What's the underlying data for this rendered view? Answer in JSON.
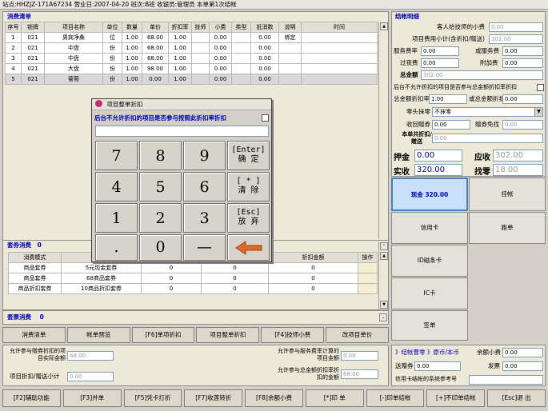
{
  "status_bar": "站点:HHZJZ-171A67234 营业日:2007-04-20 班次:B班 收银员:管理员 本单第1次结帐",
  "consume_list": {
    "title": "消费清单",
    "columns": [
      "序号",
      "锁牌",
      "项目名称",
      "单位",
      "数量",
      "单价",
      "折扣率",
      "技师",
      "小费",
      "类型",
      "抵消数",
      "说明",
      "时间"
    ],
    "rows": [
      [
        "1",
        "021",
        "男宾净桑",
        "位",
        "1.00",
        "68.00",
        "1.00",
        "",
        "0.00",
        "",
        "0.00",
        "绑定",
        ""
      ],
      [
        "2",
        "021",
        "中盘",
        "份",
        "1.00",
        "68.00",
        "1.00",
        "",
        "0.00",
        "",
        "0.00",
        "",
        ""
      ],
      [
        "3",
        "021",
        "中盘",
        "份",
        "1.00",
        "68.00",
        "1.00",
        "",
        "0.00",
        "",
        "0.00",
        "",
        ""
      ],
      [
        "4",
        "021",
        "大盘",
        "份",
        "1.00",
        "98.00",
        "1.00",
        "",
        "0.00",
        "",
        "0.00",
        "",
        ""
      ],
      [
        "5",
        "021",
        "菊萄",
        "份",
        "1.00",
        "0.00",
        "1.00",
        "",
        "0.00",
        "",
        "0.00",
        "",
        ""
      ]
    ]
  },
  "voucher": {
    "title": "套券消费",
    "count": "0",
    "columns": [
      "消费模式",
      "",
      "",
      "",
      "折扣金额",
      "操作"
    ],
    "rows": [
      [
        "商品套券",
        "5元现金套券",
        "0",
        "0",
        "0",
        ""
      ],
      [
        "商品套券",
        "68商品套券",
        "0",
        "0",
        "0",
        ""
      ],
      [
        "商品折扣套券",
        "10商品折扣套券",
        "0",
        "0",
        "0",
        ""
      ]
    ]
  },
  "package": {
    "title": "套票消费",
    "count": "0"
  },
  "action_buttons": [
    "消费清单",
    "帐单预览",
    "[F6]单项折扣",
    "项目整单折扣",
    "[F4]技师小费",
    "改项目单价"
  ],
  "bottom_left": {
    "allow_free_label": "允许参与赠券折扣的项目实际金额",
    "allow_free_value": "68.00",
    "subtotal_label": "项目折扣/赠送小计",
    "subtotal_value": "0.00",
    "allow_service_label": "允许参与服务费率计算的项目金额",
    "allow_service_value": "0.00",
    "allow_total_label": "允许参与总金额折扣率折扣的金额",
    "allow_total_value": "68.00"
  },
  "function_keys": [
    "[F2]辅助功能",
    "[F3]并单",
    "[F5]凭卡打折",
    "[F7]收莲转折",
    "[F8]余额小费",
    "[*]印 单",
    "[-]印单结帐",
    "[+]不印单结帐",
    "[Esc]退 出"
  ],
  "settlement": {
    "title": "结帐明细",
    "guest_tip_label": "客人给技师的小费",
    "guest_tip_value": "0.00",
    "item_total_label": "项目费用小计(含折扣/赠送)",
    "item_total_value": "302.00",
    "service_rate_label": "服务费率",
    "service_rate_value": "0.00",
    "service_fee_label": "或服务费",
    "service_fee_value": "0.00",
    "overnight_label": "过夜费",
    "overnight_value": "0.00",
    "extra_fee_label": "附加费",
    "extra_fee_value": "0.00",
    "total_label": "总金额",
    "total_value": "302.00",
    "no_discount_label": "后台不允许折扣的项目是否参与总金额折扣率折扣",
    "total_rate_label": "总金额折扣率",
    "total_rate_value": "1.00",
    "total_amount_label": "或总金额折扣",
    "total_amount_value": "0.00",
    "rounding_label": "零头抹零",
    "rounding_value": "不抹零",
    "coupon_label": "收回赠券",
    "coupon_value": "0.00",
    "gift_label": "赠券免找",
    "gift_value": "0.00",
    "shared_label": "本单共折扣/赠送",
    "shared_value": "0.00",
    "deposit_label": "押金",
    "deposit_value": "0.00",
    "receivable_label": "应收",
    "receivable_value": "302.00",
    "received_label": "实收",
    "received_value": "320.00",
    "change_label": "找零",
    "change_value": "18.00"
  },
  "payments": {
    "cash": "现金 320.00",
    "hang": "挂帐",
    "credit": "信用卡",
    "run": "跑单",
    "idcard": "ID磁条卡",
    "ic": "IC卡",
    "sign": "签单"
  },
  "right_bottom": {
    "settle_link": "》结帐曹零 》原币/本币",
    "balance_label": "余额小费",
    "balance_value": "0.00",
    "send_label": "送赠券",
    "send_value": "0.00",
    "invoice_label": "发票",
    "invoice_value": "0.00",
    "credit_ref_label": "信用卡结帐的系统参考号",
    "credit_ref_value": ""
  },
  "dialog": {
    "title": "项目整单折扣",
    "question": "后台不允许折扣的项目是否参与按照此折扣率折扣",
    "input_value": "",
    "keys": [
      {
        "label": "7"
      },
      {
        "label": "8"
      },
      {
        "label": "9"
      },
      {
        "label": "[Enter]\n确 定"
      },
      {
        "label": "4"
      },
      {
        "label": "5"
      },
      {
        "label": "6"
      },
      {
        "label": "[ * ]\n清 除"
      },
      {
        "label": "1"
      },
      {
        "label": "2"
      },
      {
        "label": "3"
      },
      {
        "label": "[Esc]\n放 弃"
      },
      {
        "label": "."
      },
      {
        "label": "0"
      },
      {
        "label": "—"
      }
    ]
  }
}
